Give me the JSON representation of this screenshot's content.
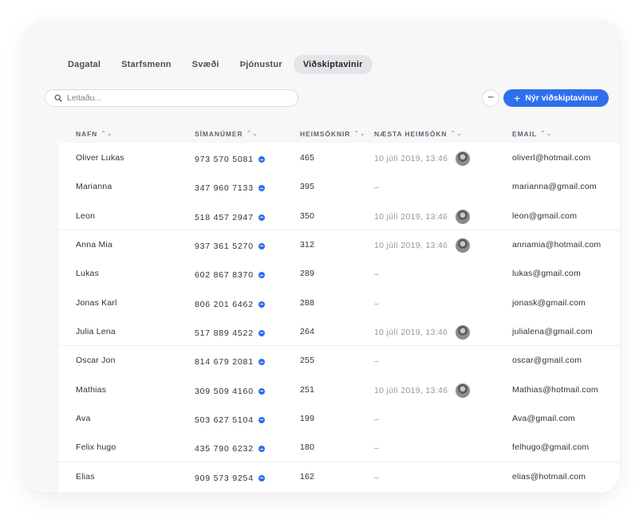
{
  "tabs": [
    {
      "label": "Dagatal",
      "active": false
    },
    {
      "label": "Starfsmenn",
      "active": false
    },
    {
      "label": "Svæði",
      "active": false
    },
    {
      "label": "Þjónustur",
      "active": false
    },
    {
      "label": "Viðskiptavinir",
      "active": true
    }
  ],
  "search": {
    "placeholder": "Leitaðu...",
    "value": ""
  },
  "toolbar": {
    "more_label": "···",
    "new_customer_label": "Nýr viðskiptavinur",
    "accent_color": "#2f6fed"
  },
  "columns": {
    "name": "NAFN",
    "phone": "SÍMANÚMER",
    "visits": "HEIMSÓKNIR",
    "next_visit": "NÆSTA HEIMSÓKN",
    "email": "EMAIL"
  },
  "rows": [
    {
      "name": "Oliver Lukas",
      "phone": "973 570 5081",
      "visits": "465",
      "next_visit": "10 júlí 2019, 13:46",
      "has_avatar": true,
      "email": "oliverl@hotmail.com"
    },
    {
      "name": "Marianna",
      "phone": "347 960 7133",
      "visits": "395",
      "next_visit": "–",
      "has_avatar": false,
      "email": "marianna@gmail.com"
    },
    {
      "name": "Leon",
      "phone": "518 457 2947",
      "visits": "350",
      "next_visit": "10 júlí 2019, 13:46",
      "has_avatar": true,
      "email": "leon@gmail.com"
    },
    {
      "name": "Anna Mia",
      "phone": "937 361 5270",
      "visits": "312",
      "next_visit": "10 júlí 2019, 13:46",
      "has_avatar": true,
      "email": "annamia@hotmail.com"
    },
    {
      "name": "Lukas",
      "phone": "602 867 8370",
      "visits": "289",
      "next_visit": "–",
      "has_avatar": false,
      "email": "lukas@gmail.com"
    },
    {
      "name": "Jonas Karl",
      "phone": "806 201 6462",
      "visits": "288",
      "next_visit": "–",
      "has_avatar": false,
      "email": "jonask@gmail.com"
    },
    {
      "name": "Julia Lena",
      "phone": "517 889 4522",
      "visits": "264",
      "next_visit": "10 júlí 2019, 13:46",
      "has_avatar": true,
      "email": "julialena@gmail.com"
    },
    {
      "name": "Oscar Jon",
      "phone": "814 679 2081",
      "visits": "255",
      "next_visit": "–",
      "has_avatar": false,
      "email": "oscar@gmail.com"
    },
    {
      "name": "Mathias",
      "phone": "309 509 4160",
      "visits": "251",
      "next_visit": "10 júlí 2019, 13:46",
      "has_avatar": true,
      "email": "Mathias@hotmail.com"
    },
    {
      "name": "Ava",
      "phone": "503 627 5104",
      "visits": "199",
      "next_visit": "–",
      "has_avatar": false,
      "email": "Ava@gmail.com"
    },
    {
      "name": "Felix hugo",
      "phone": "435 790 6232",
      "visits": "180",
      "next_visit": "–",
      "has_avatar": false,
      "email": "felhugo@gmail.com"
    },
    {
      "name": "Elias",
      "phone": "909 573 9254",
      "visits": "162",
      "next_visit": "–",
      "has_avatar": false,
      "email": "elias@hotmail.com"
    }
  ]
}
